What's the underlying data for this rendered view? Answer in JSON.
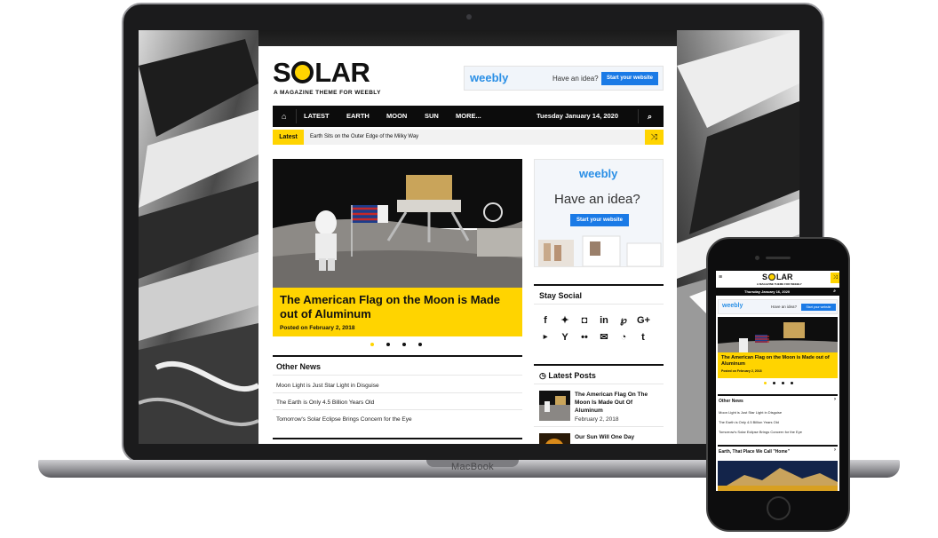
{
  "laptop": {
    "brand": "MacBook",
    "site": {
      "logo": {
        "pre": "S",
        "post": "LAR"
      },
      "tagline": "A MAGAZINE THEME FOR WEEBLY",
      "ad_top": {
        "brand": "weebly",
        "text": "Have an idea?",
        "button": "Start your website"
      },
      "nav": {
        "home_icon": "home-icon",
        "items": [
          "LATEST",
          "EARTH",
          "MOON",
          "SUN",
          "MORE..."
        ],
        "date": "Tuesday January 14, 2020",
        "search_icon": "search-icon"
      },
      "ticker": {
        "label": "Latest",
        "text": "Earth Sits on the Outer Edge of the Milky Way",
        "shuffle_icon": "shuffle-icon"
      },
      "hero": {
        "title": "The American Flag on the Moon is Made out of Aluminum",
        "date": "Posted on February 2, 2018",
        "slides": 4,
        "active_slide": 1
      },
      "other_news": {
        "heading": "Other News",
        "items": [
          "Moon Light is Just Star Light in Disguise",
          "The Earth is Only 4.5 Billion Years Old",
          "Tomorrow's Solar Eclipse Brings Concern for the Eye"
        ]
      },
      "ad_side": {
        "brand": "weebly",
        "text": "Have an idea?",
        "button": "Start your website"
      },
      "stay_social": {
        "heading": "Stay Social",
        "icons": [
          "facebook-icon",
          "twitter-icon",
          "instagram-icon",
          "linkedin-icon",
          "pinterest-icon",
          "google-plus-icon",
          "youtube-icon",
          "yahoo-icon",
          "flickr-icon",
          "email-icon",
          "rss-icon",
          "tumblr-icon"
        ]
      },
      "latest_posts": {
        "heading": "Latest Posts",
        "posts": [
          {
            "title": "The American Flag On The Moon Is Made Out Of Aluminum",
            "date": "February 2, 2018"
          },
          {
            "title": "Our Sun Will One Day",
            "date": ""
          }
        ]
      }
    }
  },
  "phone": {
    "logo": {
      "pre": "S",
      "post": "LAR"
    },
    "tagline": "A MAGAZINE THEME FOR WEEBLY",
    "date": "Thursday January 16, 2020",
    "ad": {
      "brand": "weebly",
      "text": "Have an idea?",
      "button": "Start your website"
    },
    "hero": {
      "title": "The American Flag on the Moon is Made out of Aluminum",
      "date": "Posted on February 2, 2018"
    },
    "other_news": {
      "heading": "Other News",
      "items": [
        "Moon Light is Just Star Light in Disguise",
        "The Earth is Only 4.5 Billion Years Old",
        "Tomorrow's Solar Eclipse Brings Concern for the Eye"
      ]
    },
    "feature": {
      "heading": "Earth, That Place We Call \"Home\""
    }
  },
  "colors": {
    "accent": "#ffd400",
    "nav_bg": "#0c0c0c",
    "weebly_blue": "#2a8fe6",
    "button_blue": "#1a7ae6"
  }
}
